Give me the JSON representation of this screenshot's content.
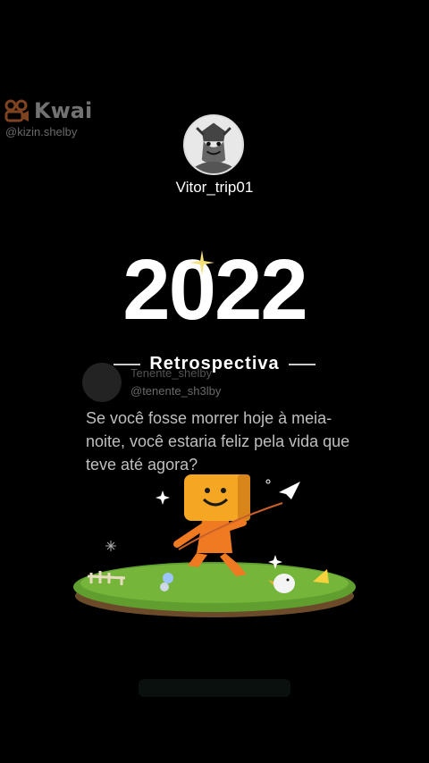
{
  "watermark": {
    "brand": "Kwai",
    "handle": "@kizin.shelby",
    "logo_icon": "kwai-logo-icon"
  },
  "profile": {
    "username": "Vitor_trip01",
    "avatar_icon": "samurai-avatar"
  },
  "title": {
    "year": "2022",
    "subtitle": "Retrospectiva"
  },
  "tweet": {
    "name": "Tenente_shelby",
    "handle": "@tenente_sh3lby",
    "body": "Se você fosse morrer hoje à meia-noite, você estaria feliz pela vida que teve até agora?"
  },
  "colors": {
    "background": "#000000",
    "text": "#ffffff",
    "mascot": "#f5a623",
    "grass": "#5f9e2f"
  }
}
